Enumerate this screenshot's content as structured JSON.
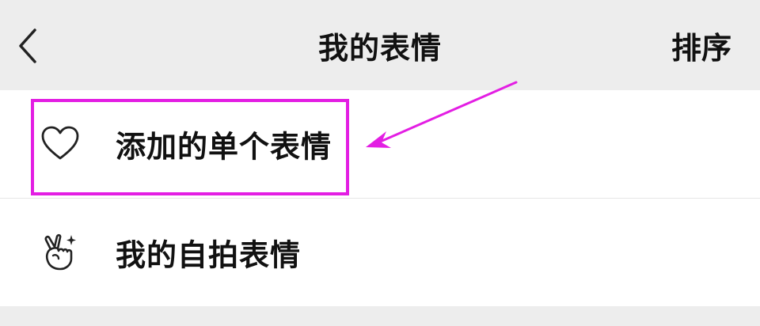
{
  "header": {
    "title": "我的表情",
    "sort_label": "排序"
  },
  "list": {
    "items": [
      {
        "label": "添加的单个表情",
        "icon": "heart-outline-icon"
      },
      {
        "label": "我的自拍表情",
        "icon": "finger-heart-sparkle-icon"
      }
    ]
  },
  "annotation": {
    "color": "#e31ee3"
  }
}
